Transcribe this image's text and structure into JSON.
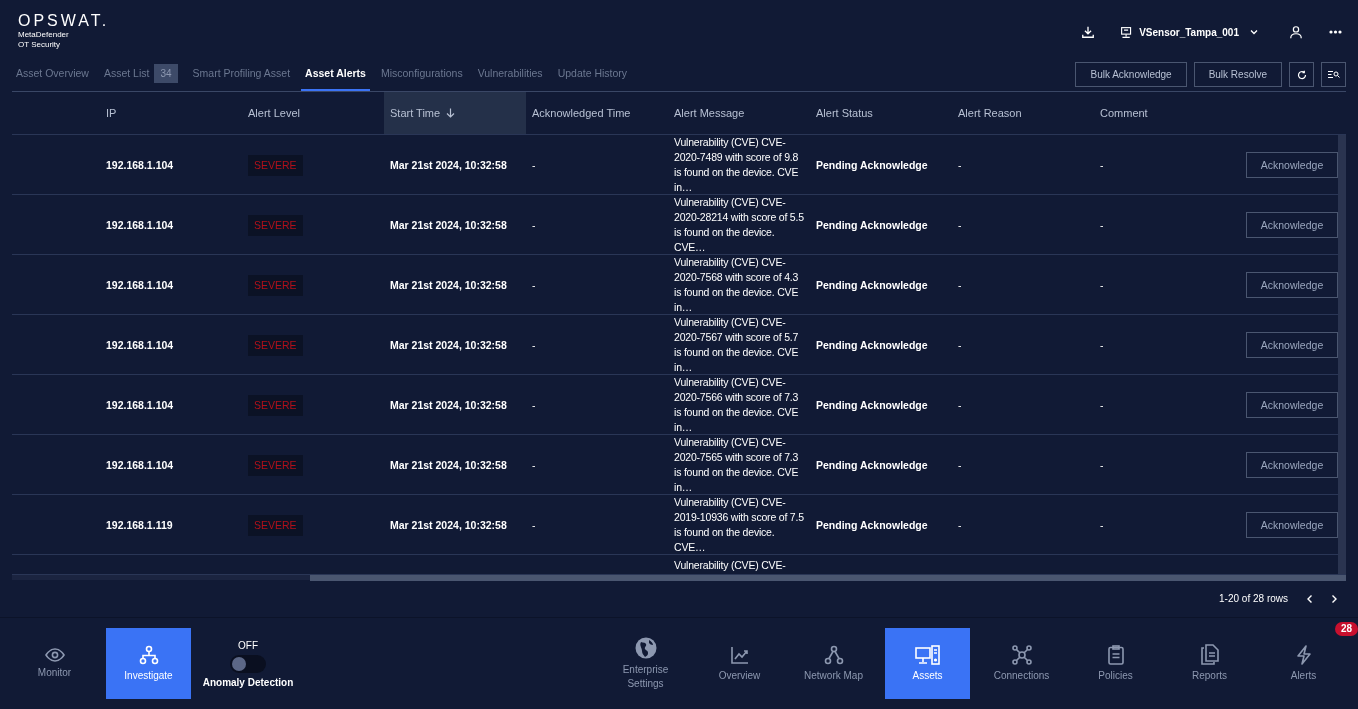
{
  "brand": {
    "logo": "OPSWAT.",
    "product": "MetaDefender",
    "subtitle": "OT Security"
  },
  "topbar": {
    "sensor": "VSensor_Tampa_001"
  },
  "tabs": [
    {
      "label": "Asset Overview",
      "selected": false
    },
    {
      "label": "Asset List",
      "count": "34",
      "selected": false
    },
    {
      "label": "Smart Profiling Asset",
      "selected": false
    },
    {
      "label": "Asset Alerts",
      "selected": true
    },
    {
      "label": "Misconfigurations",
      "selected": false
    },
    {
      "label": "Vulnerabilities",
      "selected": false
    },
    {
      "label": "Update History",
      "selected": false
    }
  ],
  "actions": [
    "Bulk Acknowledge",
    "Bulk Resolve"
  ],
  "table": {
    "columns": [
      {
        "label": "IP",
        "sorted": false
      },
      {
        "label": "Alert Level",
        "sorted": false
      },
      {
        "label": "Start Time",
        "sorted": true
      },
      {
        "label": "Acknowledged Time",
        "sorted": false
      },
      {
        "label": "Alert Message",
        "sorted": false
      },
      {
        "label": "Alert Status",
        "sorted": false
      },
      {
        "label": "Alert Reason",
        "sorted": false
      },
      {
        "label": "Comment",
        "sorted": false
      }
    ],
    "rows": [
      {
        "ip": "192.168.1.104",
        "level": "SEVERE",
        "start": "Mar 21st 2024, 10:32:58",
        "ack_time": "-",
        "message": "Vulnerability (CVE) CVE-2020-7489 with score of 9.8 is found on the device. CVE in…",
        "status": "Pending Acknowledge",
        "reason": "-",
        "comment": "-",
        "action": "Acknowledge"
      },
      {
        "ip": "192.168.1.104",
        "level": "SEVERE",
        "start": "Mar 21st 2024, 10:32:58",
        "ack_time": "-",
        "message": "Vulnerability (CVE) CVE-2020-28214 with score of 5.5 is found on the device. CVE…",
        "status": "Pending Acknowledge",
        "reason": "-",
        "comment": "-",
        "action": "Acknowledge"
      },
      {
        "ip": "192.168.1.104",
        "level": "SEVERE",
        "start": "Mar 21st 2024, 10:32:58",
        "ack_time": "-",
        "message": "Vulnerability (CVE) CVE-2020-7568 with score of 4.3 is found on the device. CVE in…",
        "status": "Pending Acknowledge",
        "reason": "-",
        "comment": "-",
        "action": "Acknowledge"
      },
      {
        "ip": "192.168.1.104",
        "level": "SEVERE",
        "start": "Mar 21st 2024, 10:32:58",
        "ack_time": "-",
        "message": "Vulnerability (CVE) CVE-2020-7567 with score of 5.7 is found on the device. CVE in…",
        "status": "Pending Acknowledge",
        "reason": "-",
        "comment": "-",
        "action": "Acknowledge"
      },
      {
        "ip": "192.168.1.104",
        "level": "SEVERE",
        "start": "Mar 21st 2024, 10:32:58",
        "ack_time": "-",
        "message": "Vulnerability (CVE) CVE-2020-7566 with score of 7.3 is found on the device. CVE in…",
        "status": "Pending Acknowledge",
        "reason": "-",
        "comment": "-",
        "action": "Acknowledge"
      },
      {
        "ip": "192.168.1.104",
        "level": "SEVERE",
        "start": "Mar 21st 2024, 10:32:58",
        "ack_time": "-",
        "message": "Vulnerability (CVE) CVE-2020-7565 with score of 7.3 is found on the device. CVE in…",
        "status": "Pending Acknowledge",
        "reason": "-",
        "comment": "-",
        "action": "Acknowledge"
      },
      {
        "ip": "192.168.1.119",
        "level": "SEVERE",
        "start": "Mar 21st 2024, 10:32:58",
        "ack_time": "-",
        "message": "Vulnerability (CVE) CVE-2019-10936 with score of 7.5 is found on the device. CVE…",
        "status": "Pending Acknowledge",
        "reason": "-",
        "comment": "-",
        "action": "Acknowledge"
      }
    ],
    "partial_row": {
      "message": "Vulnerability (CVE) CVE-"
    }
  },
  "pagination": {
    "summary": "1-20 of 28 rows"
  },
  "nav_left": [
    {
      "label": "Monitor",
      "selected": false
    },
    {
      "label": "Investigate",
      "selected": true
    }
  ],
  "anomaly": {
    "state_label": "OFF",
    "label": "Anomaly Detection",
    "on": false
  },
  "nav_right": [
    {
      "label": "Enterprise Settings",
      "selected": false
    },
    {
      "label": "Overview",
      "selected": false
    },
    {
      "label": "Network Map",
      "selected": false
    },
    {
      "label": "Assets",
      "selected": true
    },
    {
      "label": "Connections",
      "selected": false
    },
    {
      "label": "Policies",
      "selected": false
    },
    {
      "label": "Reports",
      "selected": false
    },
    {
      "label": "Alerts",
      "selected": false,
      "badge": "28"
    }
  ]
}
